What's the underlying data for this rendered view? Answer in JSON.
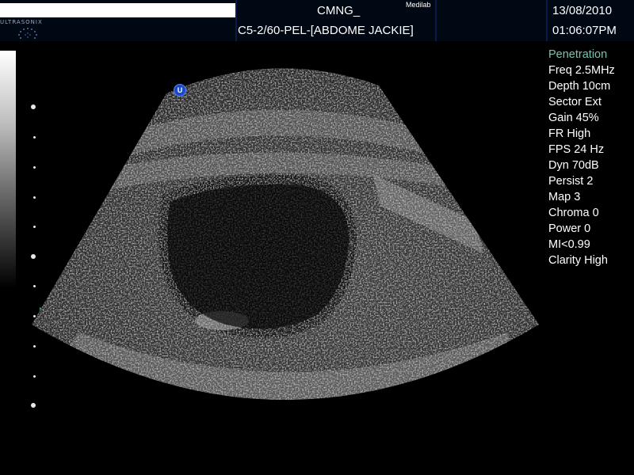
{
  "header": {
    "patient_name_value": "",
    "facility": "CMNG_",
    "site": "Medilab",
    "probe_preset": "C5-2/60-PEL-[ABDOME JACKIE]",
    "date": "13/08/2010",
    "time": "01:06:07PM",
    "logo_text": "ULTRASONIX"
  },
  "orientation_marker": "U",
  "parameters": {
    "mode": "Penetration",
    "items": [
      "Freq 2.5MHz",
      "Depth 10cm",
      "Sector Ext",
      "Gain 45%",
      "FR High",
      "FPS 24 Hz",
      "Dyn 70dB",
      "Persist 2",
      "Map 3",
      "Chroma 0",
      "Power 0",
      "MI<0.99",
      "Clarity High"
    ]
  },
  "colors": {
    "background": "#000000",
    "header_bg": "#000814",
    "header_divider": "#0a1a4a",
    "mode_text": "#7ec0ae",
    "focus_marker": "#39a087",
    "orientation_marker": "#1a49c8"
  },
  "icons": [
    "orientation-marker-icon",
    "focus-marker-icon",
    "ultrasonix-logo-icon"
  ]
}
